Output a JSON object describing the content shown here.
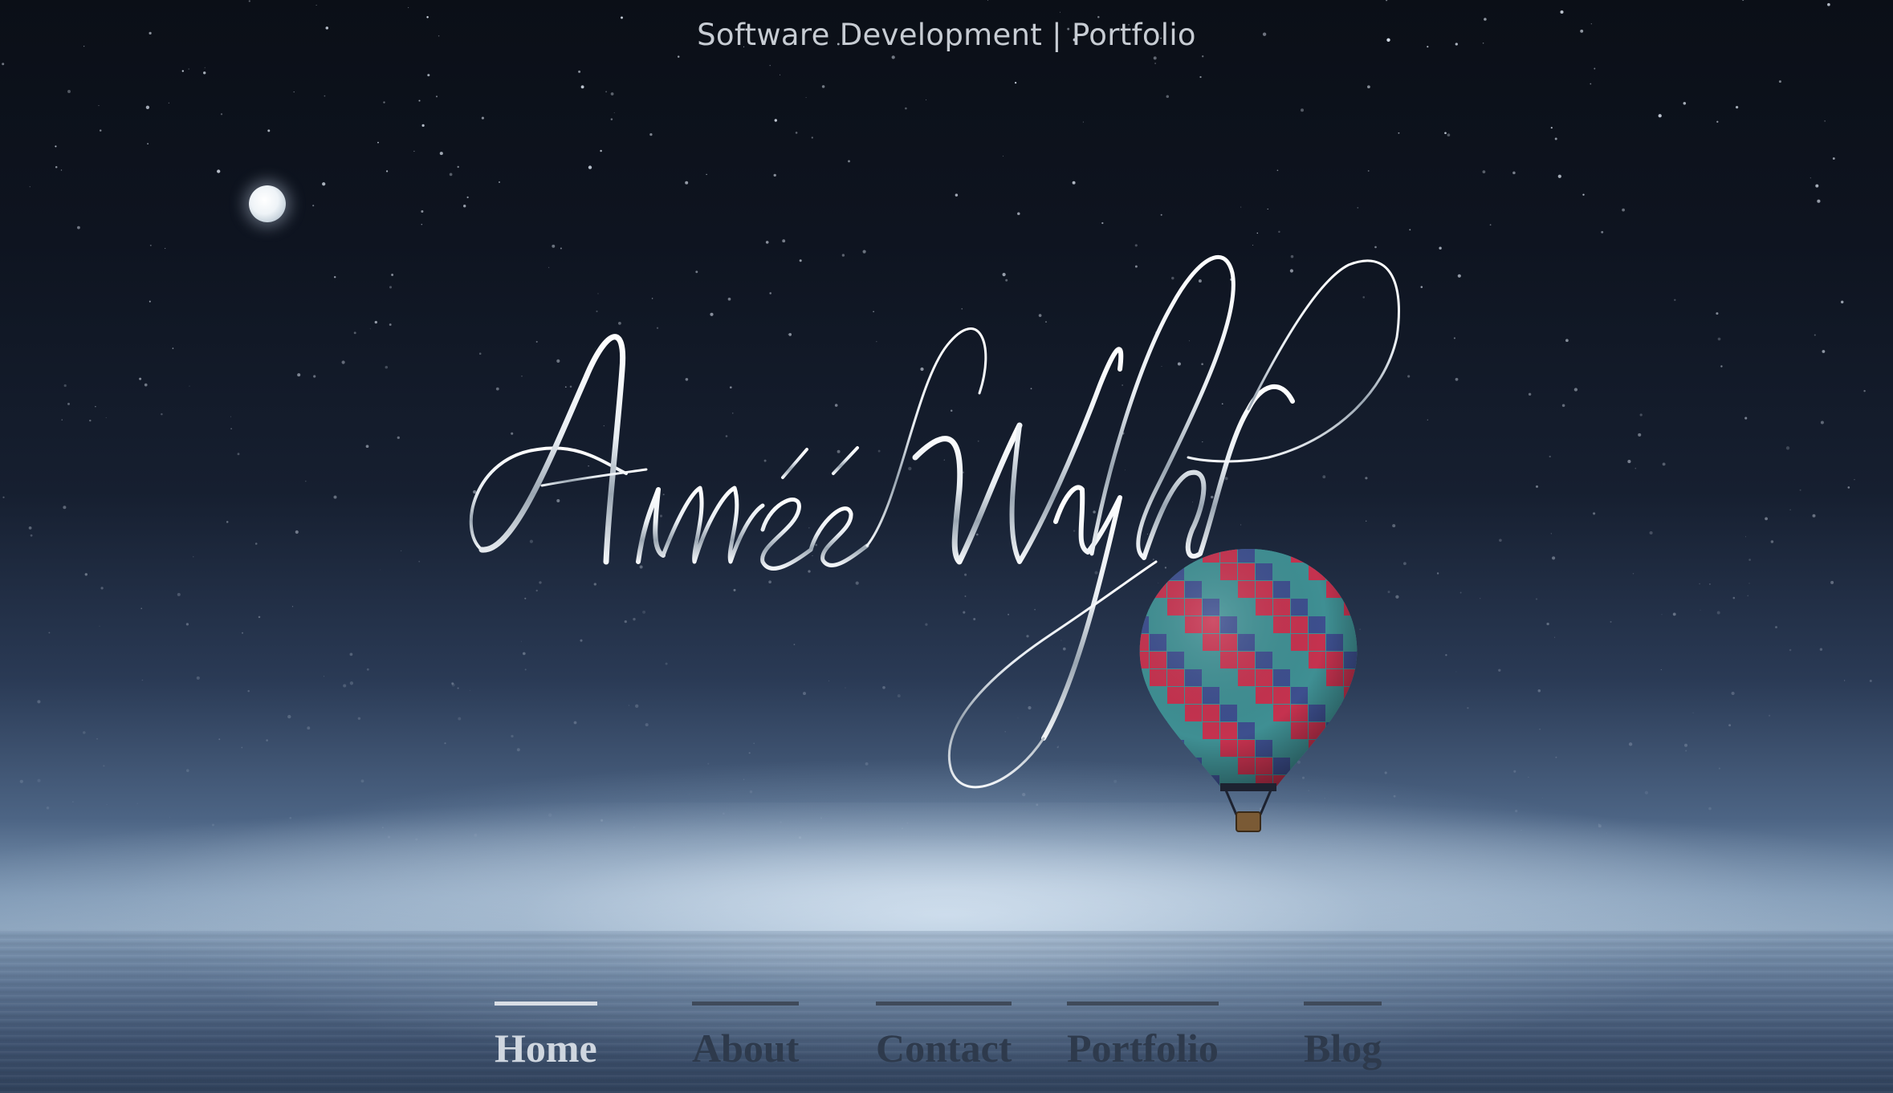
{
  "header": {
    "tagline": "Software Development | Portfolio"
  },
  "hero": {
    "signature_text": "Aimée Wyld"
  },
  "nav": {
    "items": [
      {
        "label": "Home",
        "active": true
      },
      {
        "label": "About",
        "active": false
      },
      {
        "label": "Contact",
        "active": false
      },
      {
        "label": "Portfolio",
        "active": false
      },
      {
        "label": "Blog",
        "active": false
      }
    ]
  },
  "colors": {
    "sky_top": "#0b0f17",
    "horizon_glow": "#c8d8e8",
    "nav_active": "#cfd6df",
    "nav_inactive": "#2e3a4c",
    "balloon_red": "#c5324f",
    "balloon_teal": "#3f8f93",
    "balloon_blue": "#3d4f8e"
  },
  "icons": {
    "moon": "moon-icon",
    "balloon": "hot-air-balloon-icon"
  }
}
